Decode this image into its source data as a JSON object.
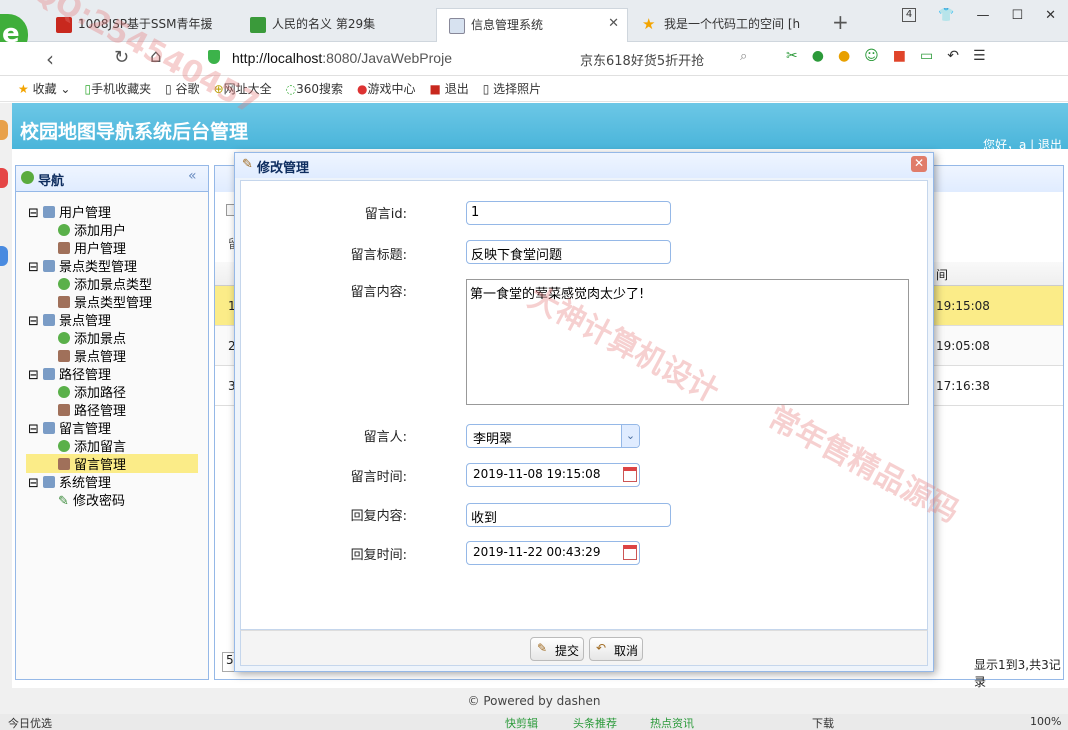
{
  "browser": {
    "tabs": [
      {
        "title": "1008JSP基于SSM青年援",
        "active": false
      },
      {
        "title": "人民的名义 第29集",
        "active": false
      },
      {
        "title": "信息管理系统",
        "active": true
      },
      {
        "title": "我是一个代码工的空间 [h",
        "active": false
      }
    ],
    "new_tab": "+",
    "window_count": "4",
    "url_host": "http://localhost",
    "url_rest": ":8080/JavaWebProje",
    "hot_search": "京东618好货5折开抢",
    "bookmarks": [
      "收藏",
      "手机收藏夹",
      "谷歌",
      "网址大全",
      "360搜索",
      "游戏中心",
      "退出",
      "选择照片"
    ]
  },
  "app": {
    "title": "校园地图导航系统后台管理",
    "greeting": "您好，a | 退出",
    "nav_title": "导航",
    "nav_groups": [
      {
        "label": "用户管理",
        "items": [
          "添加用户",
          "用户管理"
        ]
      },
      {
        "label": "景点类型管理",
        "items": [
          "添加景点类型",
          "景点类型管理"
        ]
      },
      {
        "label": "景点管理",
        "items": [
          "添加景点",
          "景点管理"
        ]
      },
      {
        "label": "路径管理",
        "items": [
          "添加路径",
          "路径管理"
        ]
      },
      {
        "label": "留言管理",
        "items": [
          "添加留言",
          "留言管理"
        ]
      },
      {
        "label": "系统管理",
        "items": [
          "修改密码"
        ]
      }
    ],
    "selected_item": "留言管理",
    "bg_table": {
      "col_header": "间",
      "rows": [
        {
          "idx": "1",
          "time": "19:15:08"
        },
        {
          "idx": "2",
          "time": "19:05:08"
        },
        {
          "idx": "3",
          "time": "17:16:38"
        }
      ],
      "bg_label": "留",
      "pager_size": "5",
      "pager_info": "显示1到3,共3记录"
    },
    "footer": "© Powered by dashen"
  },
  "dialog": {
    "title": "修改管理",
    "fields": {
      "id_label": "留言id:",
      "id_value": "1",
      "title_label": "留言标题:",
      "title_value": "反映下食堂问题",
      "content_label": "留言内容:",
      "content_value": "第一食堂的荤菜感觉肉太少了!",
      "person_label": "留言人:",
      "person_value": "李明翠",
      "time_label": "留言时间:",
      "time_value": "2019-11-08 19:15:08",
      "reply_label": "回复内容:",
      "reply_value": "收到",
      "reply_time_label": "回复时间:",
      "reply_time_value": "2019-11-22 00:43:29"
    },
    "submit": "提交",
    "cancel": "取消"
  },
  "status": {
    "left": "今日优选",
    "items": [
      "快剪辑",
      "头条推荐",
      "热点资讯",
      "下载"
    ],
    "zoom": "100%"
  },
  "watermarks": [
    "QQ:254540457",
    "大神计算机设计",
    "常年售精品源码"
  ],
  "colors": {
    "header": "#4ab5da",
    "border": "#95b8e7",
    "selected": "#fbec88"
  }
}
